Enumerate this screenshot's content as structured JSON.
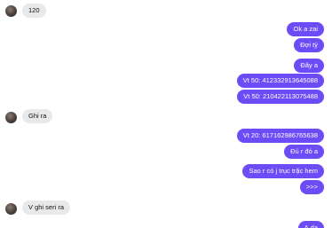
{
  "colors": {
    "outgoing_bubble": "#6b4cf6",
    "incoming_bubble": "#e9e9eb",
    "background": "#ffffff"
  },
  "messages": [
    {
      "sender": "them",
      "text": "120"
    },
    {
      "sender": "me",
      "text": "Ok a zai"
    },
    {
      "sender": "me",
      "text": "Đợi tý"
    },
    {
      "sender": "me",
      "text": "Đây a"
    },
    {
      "sender": "me",
      "text": "Vt 50: 412332913645088"
    },
    {
      "sender": "me",
      "text": "Vt 50: 210422113075488"
    },
    {
      "sender": "them",
      "text": "Ghi ra"
    },
    {
      "sender": "me",
      "text": "Vt 20: 617162986765638"
    },
    {
      "sender": "me",
      "text": "Đủ r đó a"
    },
    {
      "sender": "me",
      "text": "Sao r có j trục trặc hem"
    },
    {
      "sender": "me",
      "text": ">>>"
    },
    {
      "sender": "them",
      "text": "V ghi seri ra"
    },
    {
      "sender": "me",
      "text": "Ạ dạ"
    }
  ]
}
